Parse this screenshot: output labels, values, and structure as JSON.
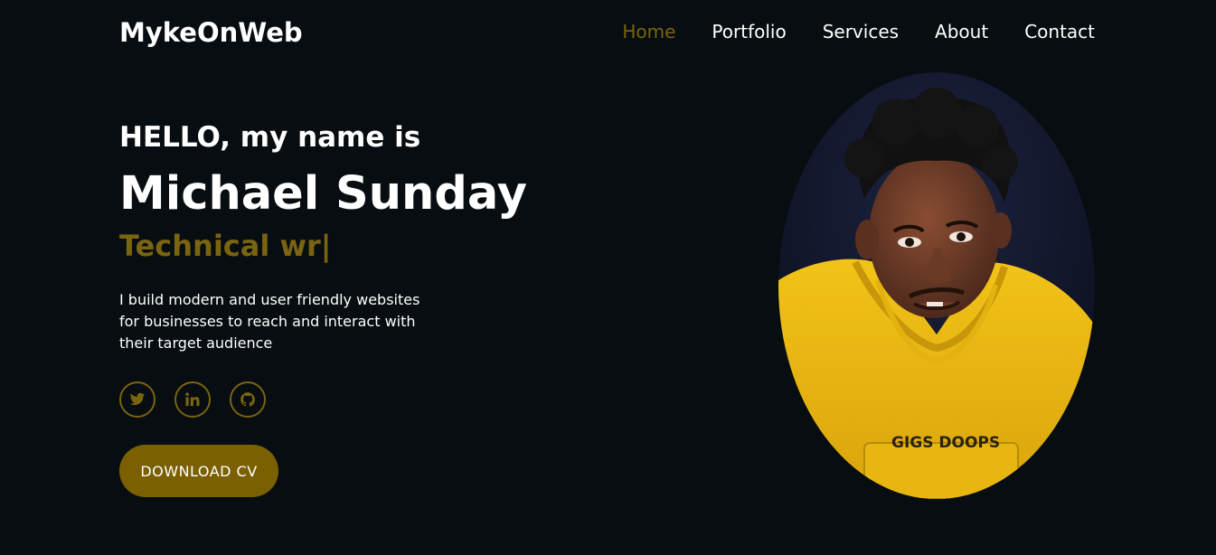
{
  "header": {
    "logo": "MykeOnWeb",
    "nav": [
      {
        "label": "Home",
        "active": true
      },
      {
        "label": "Portfolio",
        "active": false
      },
      {
        "label": "Services",
        "active": false
      },
      {
        "label": "About",
        "active": false
      },
      {
        "label": "Contact",
        "active": false
      }
    ]
  },
  "hero": {
    "greeting": "HELLO, my name is",
    "name": "Michael Sunday",
    "role": "Technical wr|",
    "bio": "I build modern and user friendly websites for businesses to reach and interact with their target audience",
    "socials": [
      {
        "icon": "twitter-icon"
      },
      {
        "icon": "linkedin-icon"
      },
      {
        "icon": "github-icon"
      }
    ],
    "cta_label": "DOWNLOAD CV",
    "portrait_caption": ""
  },
  "colors": {
    "background": "#070d10",
    "accent": "#7a6410",
    "button": "#7a6000",
    "text": "#ffffff"
  }
}
